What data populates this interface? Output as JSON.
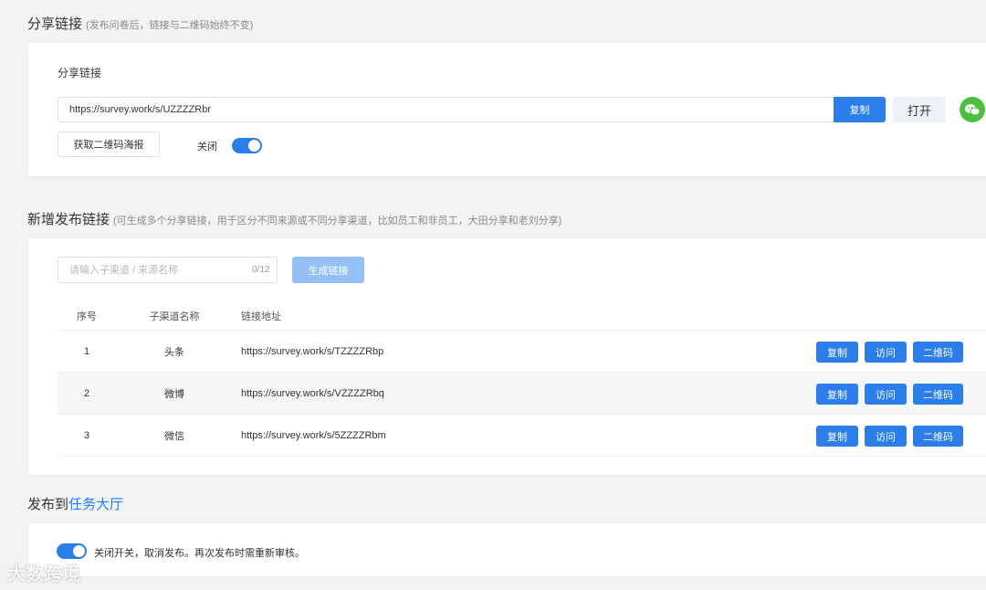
{
  "share": {
    "title": "分享链接",
    "hint": "(发布问卷后，链接与二维码始终不变)",
    "card_label": "分享链接",
    "url": "https://survey.work/s/UZZZZRbr",
    "copy_label": "复制",
    "open_label": "打开",
    "qr_poster_label": "获取二维码海报",
    "toggle_label": "关闭",
    "toggle_on": true
  },
  "channels": {
    "title": "新增发布链接",
    "hint": "(可生成多个分享链接，用于区分不同来源或不同分享渠道，比如员工和非员工，大田分享和老刘分享)",
    "input_placeholder": "请输入子渠道 / 来源名称",
    "counter": "0/12",
    "generate_label": "生成链接",
    "columns": [
      "序号",
      "子渠道名称",
      "链接地址"
    ],
    "rows": [
      {
        "index": "1",
        "name": "头条",
        "url": "https://survey.work/s/TZZZZRbp"
      },
      {
        "index": "2",
        "name": "微博",
        "url": "https://survey.work/s/VZZZZRbq"
      },
      {
        "index": "3",
        "name": "微信",
        "url": "https://survey.work/s/5ZZZZRbm"
      }
    ],
    "row_actions": {
      "copy": "复制",
      "visit": "访问",
      "qr": "二维码"
    }
  },
  "publish": {
    "title_prefix": "发布到",
    "title_link": "任务大厅",
    "toggle_on": true,
    "notice": "关闭开关，取消发布。再次发布时需重新审核。"
  },
  "watermark": "大数跨境",
  "colors": {
    "primary": "#2b7de9",
    "wechat": "#4cbf3e",
    "link": "#1e80ff"
  },
  "icons": {
    "wechat": "wechat-icon"
  }
}
